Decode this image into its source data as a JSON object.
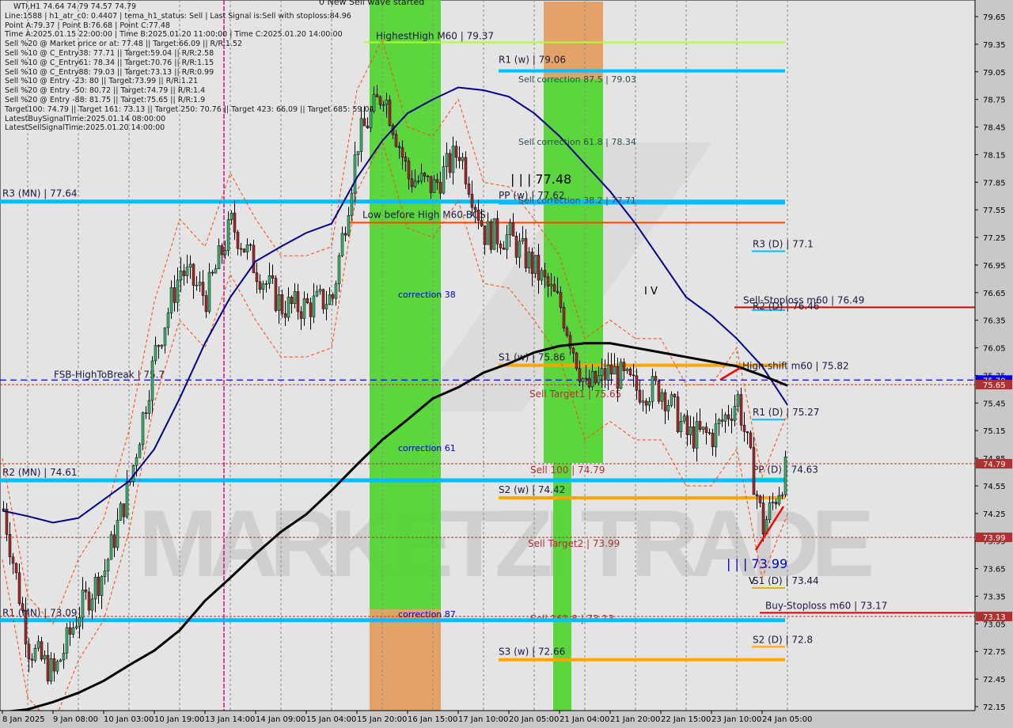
{
  "header": {
    "title": "WTI,H1  74.64 74.79 74.57 74.79",
    "lines": [
      "Line:1588 | h1_atr_c0: 0.4407 | tema_h1_status: Sell | Last Signal is:Sell with stoploss:84.96",
      "Point A:79.37 | Point B:76.68 | Point C:77.48",
      "Time A:2025.01.15 22:00:00 | Time B:2025.01.20 11:00:00 | Time C:2025.01.20 14:00:00",
      "Sell %20 @ Market price or at: 77.48 || Target:66.09 || R/R:1.52",
      "Sell %10 @ C_Entry38: 77.71 || Target:59.04 || R/R:2.58",
      "Sell %10 @ C_Entry61: 78.34 || Target:70.76 || R/R:1.15",
      "Sell %10 @ C_Entry88: 79.03 || Target:73.13 || R/R:0.99",
      "Sell %10 @ Entry -23: 80 || Target:73.99 || R/R:1.21",
      "Sell %20 @ Entry -50: 80.72 || Target:74.79 || R/R:1.4",
      "Sell %20 @ Entry -88: 81.75 || Target:75.65 || R/R:1.9",
      "Target100: 74.79 || Target 161: 73.13 || Target 250: 70.76 || Target 423: 66.09 || Target 685: 59.04",
      "LatestBuySignalTime:2025.01.14 08:00:00",
      "LatestSellSignalTime:2025.01.20 14:00:00"
    ]
  },
  "watermark": "MARKETZI TRADE",
  "chart_data": {
    "type": "candlestick",
    "symbol": "WTI",
    "timeframe": "H1",
    "ylim": [
      72.15,
      79.65
    ],
    "y_ticks": [
      "79.65",
      "79.35",
      "79.05",
      "78.75",
      "78.45",
      "78.15",
      "77.85",
      "77.55",
      "77.25",
      "76.95",
      "76.65",
      "76.35",
      "76.05",
      "75.75",
      "75.45",
      "75.15",
      "74.85",
      "74.55",
      "74.25",
      "73.95",
      "73.65",
      "73.35",
      "73.05",
      "72.75",
      "72.45",
      "72.15"
    ],
    "x_ticks": [
      "8 Jan 2025",
      "9 Jan 08:00",
      "10 Jan 03:00",
      "10 Jan 19:00",
      "13 Jan 14:00",
      "14 Jan 09:00",
      "15 Jan 04:00",
      "15 Jan 20:00",
      "16 Jan 15:00",
      "17 Jan 10:00",
      "20 Jan 05:00",
      "21 Jan 04:00",
      "21 Jan 20:00",
      "22 Jan 15:00",
      "23 Jan 10:00",
      "24 Jan 05:00"
    ],
    "close_approx": [
      74.3,
      72.8,
      72.5,
      73.2,
      73.64,
      74.6,
      76.0,
      76.9,
      76.6,
      77.4,
      76.9,
      76.5,
      76.5,
      76.6,
      78.3,
      78.85,
      77.9,
      77.8,
      78.2,
      77.3,
      77.25,
      76.9,
      76.5,
      75.6,
      75.8,
      75.6,
      75.6,
      75.1,
      75.1,
      75.5,
      74.1,
      74.79
    ],
    "ma_blue": [
      74.28,
      74.22,
      74.15,
      74.2,
      74.4,
      74.6,
      74.95,
      75.5,
      76.1,
      76.6,
      76.99,
      77.15,
      77.3,
      77.4,
      77.9,
      78.3,
      78.6,
      78.75,
      78.88,
      78.85,
      78.78,
      78.6,
      78.35,
      78.05,
      77.75,
      77.4,
      77.0,
      76.6,
      76.4,
      76.15,
      75.85,
      75.43
    ],
    "ma_black": [
      72.09,
      72.12,
      72.2,
      72.3,
      72.43,
      72.6,
      72.76,
      72.98,
      73.3,
      73.55,
      73.81,
      74.05,
      74.24,
      74.5,
      74.78,
      75.05,
      75.27,
      75.5,
      75.62,
      75.78,
      75.88,
      76.0,
      76.07,
      76.1,
      76.1,
      76.05,
      76.0,
      75.95,
      75.9,
      75.85,
      75.75,
      75.64
    ],
    "price_tags": [
      {
        "text": "75.70",
        "color": "#0000ff"
      },
      {
        "text": "75.65",
        "color": "#b03030"
      },
      {
        "text": "74.79",
        "color": "#b03030"
      },
      {
        "text": "73.99",
        "color": "#b03030"
      },
      {
        "text": "73.13",
        "color": "#b03030"
      }
    ],
    "levels": [
      {
        "label": "HighestHigh   M60 | 79.37",
        "price": 79.37,
        "color": "#adff2f"
      },
      {
        "label": "R1 (w) | 79.06",
        "price": 79.06,
        "color": "#00bfff"
      },
      {
        "label": "R3 (MN) | 77.64",
        "price": 77.64,
        "color": "#00bfff"
      },
      {
        "label": "PP (w) | 77.62",
        "price": 77.62,
        "color": "#00bfff"
      },
      {
        "label": "Low before High   M60-BOS",
        "price": 77.41,
        "color": "#ff4500"
      },
      {
        "label": "R3 (D) | 77.1",
        "price": 77.1,
        "color": "#00bfff"
      },
      {
        "label": "Sell-Stoploss m60 | 76.49",
        "price": 76.49,
        "color": "#e00000"
      },
      {
        "label": "R2 (D) | 76.46",
        "price": 76.46,
        "color": "#00bfff"
      },
      {
        "label": "S1 (w) | 75.86",
        "price": 75.86,
        "color": "#ffa500"
      },
      {
        "label": "High-shift m60 | 75.82",
        "price": 75.82,
        "color": "#ffffff"
      },
      {
        "label": "FSB-HighToBreak | 75.7",
        "price": 75.7,
        "color": "#0000ff"
      },
      {
        "label": "Sell Target1 | 75.65",
        "price": 75.65,
        "color": "#b03030"
      },
      {
        "label": "R1 (D) | 75.27",
        "price": 75.27,
        "color": "#00bfff"
      },
      {
        "label": "Sell 100 | 74.79",
        "price": 74.79,
        "color": "#b03030"
      },
      {
        "label": "PP (D) | 74.63",
        "price": 74.63,
        "color": "#00fa9a"
      },
      {
        "label": "R2 (MN) | 74.61",
        "price": 74.61,
        "color": "#00bfff"
      },
      {
        "label": "S2 (w) | 74.42",
        "price": 74.42,
        "color": "#ffa500"
      },
      {
        "label": "Sell Target2 | 73.99",
        "price": 73.99,
        "color": "#b03030"
      },
      {
        "label": "S1 (D) | 73.44",
        "price": 73.44,
        "color": "#ffa500"
      },
      {
        "label": "Buy-Stoploss m60 | 73.17",
        "price": 73.17,
        "color": "#e00000"
      },
      {
        "label": "Sell 161.8 | 73.13",
        "price": 73.13,
        "color": "#b03030"
      },
      {
        "label": "R1 (MN) | 73.09",
        "price": 73.09,
        "color": "#00bfff"
      },
      {
        "label": "S2 (D) | 72.8",
        "price": 72.8,
        "color": "#ffa500"
      },
      {
        "label": "S3 (w) | 72.66",
        "price": 72.66,
        "color": "#ffa500"
      }
    ],
    "annotations": [
      {
        "text": "0 New Sell wave started",
        "color": "#1a1a1a"
      },
      {
        "text": "Sell correction 87.5 | 79.03",
        "color": "#2f4f4f"
      },
      {
        "text": "Sell correction 61.8 | 78.34",
        "color": "#2f4f4f"
      },
      {
        "text": "Sell correction 38.2 | 77.71",
        "color": "#2f4f4f"
      },
      {
        "text": "| | | 77.48",
        "color": "#000000"
      },
      {
        "text": "correction 38",
        "color": "#0000cd"
      },
      {
        "text": "correction 61",
        "color": "#0000cd"
      },
      {
        "text": "correction 87",
        "color": "#0000cd"
      },
      {
        "text": "I V",
        "color": "#000000"
      },
      {
        "text": "| | | 73.99",
        "color": "#0000cd"
      },
      {
        "text": "V",
        "color": "#000000"
      }
    ],
    "zone_colors": {
      "green": "#4cd42a",
      "orange": "#e39a5a"
    },
    "candle_colors": {
      "up": "#3cb371",
      "down": "#a52a2a"
    }
  }
}
